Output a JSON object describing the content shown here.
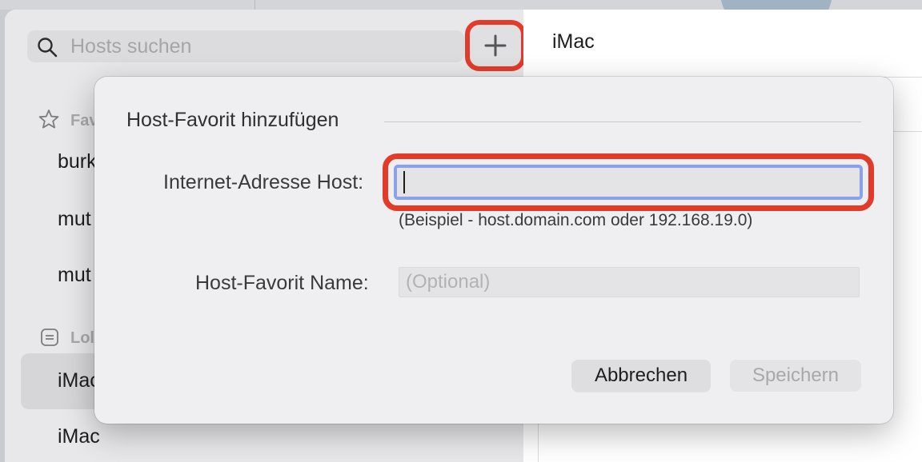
{
  "search": {
    "placeholder": "Hosts suchen",
    "icon": "search-icon"
  },
  "toolbar": {
    "add_label": "+"
  },
  "sidebar": {
    "sections": [
      {
        "label": "Fav",
        "icon": "star-icon"
      },
      {
        "label": "Lol",
        "icon": "local-hosts-icon"
      }
    ],
    "items": [
      {
        "label": "burk"
      },
      {
        "label": "mut"
      },
      {
        "label": "mut"
      },
      {
        "label": "iMac",
        "selected": true
      },
      {
        "label": "iMac"
      }
    ]
  },
  "main": {
    "title": "iMac"
  },
  "dialog": {
    "title": "Host-Favorit hinzufügen",
    "host_label": "Internet-Adresse Host:",
    "host_value": "",
    "hint": "(Beispiel - host.domain.com oder 192.168.19.0)",
    "name_label": "Host-Favorit Name:",
    "name_placeholder": "(Optional)",
    "cancel_label": "Abbrechen",
    "save_label": "Speichern"
  },
  "colors": {
    "highlight": "#e23b2a",
    "focus_ring": "#8aa2ea"
  }
}
